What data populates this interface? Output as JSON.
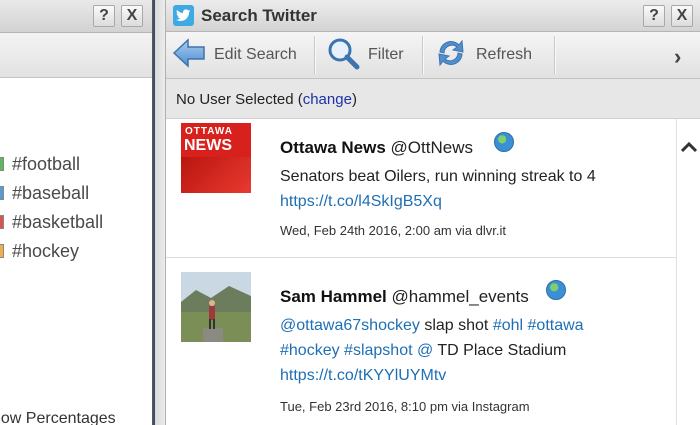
{
  "left_panel": {
    "help_label": "?",
    "close_label": "X",
    "hashtags": [
      {
        "label": "#football",
        "color": "#5cb85c"
      },
      {
        "label": "#baseball",
        "color": "#5b9bd5"
      },
      {
        "label": "#basketball",
        "color": "#d9534f"
      },
      {
        "label": "#hockey",
        "color": "#f0ad4e"
      }
    ],
    "show_percentages": "how Percentages"
  },
  "window": {
    "title": "Search Twitter",
    "help_label": "?",
    "close_label": "X"
  },
  "toolbar": {
    "edit_search_label": "Edit Search",
    "filter_label": "Filter",
    "refresh_label": "Refresh",
    "next_icon": "chevron-right-icon"
  },
  "status": {
    "text": "No User Selected (",
    "link": "change",
    "suffix": ")"
  },
  "tweets": [
    {
      "avatar_text_1": "OTTAWA",
      "avatar_text_2": "NEWS",
      "name": "Ottawa News",
      "handle": "@OttNews",
      "text_line_1": "Senators beat Oilers, run winning streak to 4",
      "link": "https://t.co/l4SkIgB5Xq",
      "meta": "Wed, Feb 24th 2016, 2:00 am via dlvr.it"
    },
    {
      "name": "Sam Hammel",
      "handle": "@hammel_events",
      "mention": "@ottawa67shockey",
      "text_mid": " slap shot ",
      "tag1": "#ohl",
      "tag2": "#ottawa",
      "tag3": "#hockey",
      "tag4": "#slapshot",
      "at": "@",
      "place": " TD Place Stadium",
      "link": "https://t.co/tKYYlUYMtv",
      "meta": "Tue, Feb 23rd 2016, 8:10 pm via Instagram"
    }
  ],
  "colors": {
    "twitter_blue": "#3fa9e4",
    "link_blue": "#1f6fb5",
    "ottawa_news_red": "#d8201c"
  }
}
